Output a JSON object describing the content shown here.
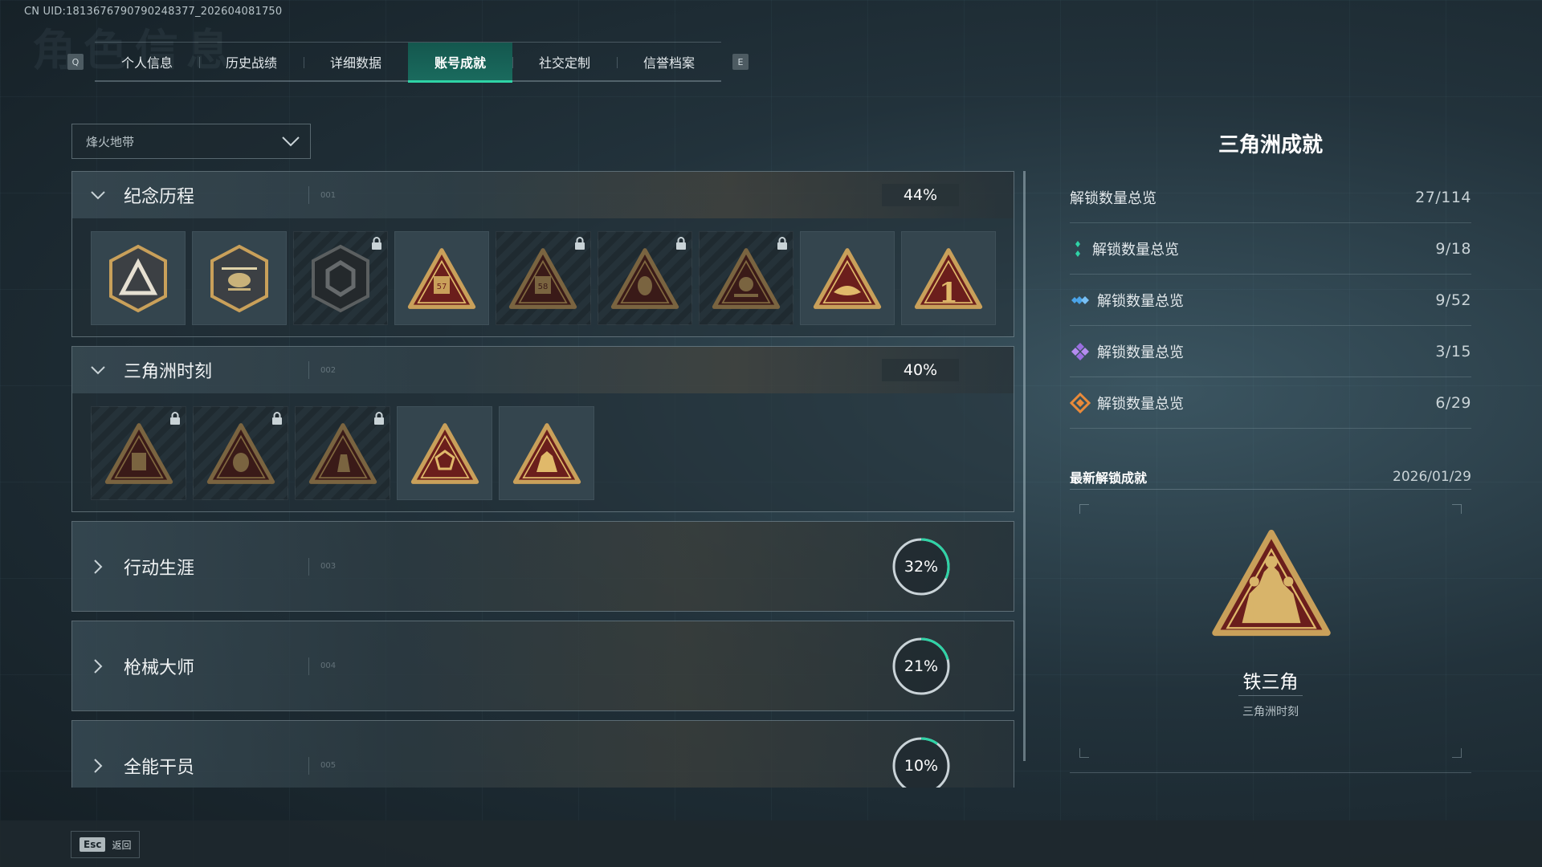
{
  "uid": "CN UID:1813676790790248377_202604081750",
  "tabbar": {
    "left_key": "Q",
    "right_key": "E",
    "tabs": [
      {
        "label": "个人信息"
      },
      {
        "label": "历史战绩"
      },
      {
        "label": "详细数据"
      },
      {
        "label": "账号成就",
        "active": true
      },
      {
        "label": "社交定制"
      },
      {
        "label": "信誉档案"
      }
    ]
  },
  "mode_select": {
    "value": "烽火地带",
    "icon": "chevron-down-icon"
  },
  "categories": [
    {
      "name": "纪念历程",
      "index": "001",
      "progress": 44,
      "progress_label": "44%",
      "expanded": true,
      "badges": [
        {
          "icon": "triangle-shield-badge",
          "locked": false
        },
        {
          "icon": "helicopter-badge",
          "locked": false
        },
        {
          "icon": "hex-emblem-badge",
          "locked": true
        },
        {
          "icon": "vault-57-badge",
          "locked": false
        },
        {
          "icon": "vault-58-badge",
          "locked": true
        },
        {
          "icon": "masked-figure-badge",
          "locked": true
        },
        {
          "icon": "skull-soldier-badge",
          "locked": true
        },
        {
          "icon": "hands-triangle-badge",
          "locked": false
        },
        {
          "icon": "number-one-badge",
          "locked": false
        }
      ]
    },
    {
      "name": "三角洲时刻",
      "index": "002",
      "progress": 40,
      "progress_label": "40%",
      "expanded": true,
      "badges": [
        {
          "icon": "robot-badge",
          "locked": true
        },
        {
          "icon": "masked-face-badge",
          "locked": true
        },
        {
          "icon": "kneeling-soldier-badge",
          "locked": true
        },
        {
          "icon": "hands-dice-badge",
          "locked": false
        },
        {
          "icon": "iron-triangle-badge",
          "locked": false
        }
      ]
    },
    {
      "name": "行动生涯",
      "index": "003",
      "progress": 32,
      "progress_label": "32%",
      "expanded": false
    },
    {
      "name": "枪械大师",
      "index": "004",
      "progress": 21,
      "progress_label": "21%",
      "expanded": false
    },
    {
      "name": "全能干员",
      "index": "005",
      "progress": 10,
      "progress_label": "10%",
      "expanded": false
    }
  ],
  "summary": {
    "title": "三角洲成就",
    "total": {
      "label": "解锁数量总览",
      "value": "27/114"
    },
    "tiers": [
      {
        "label": "解锁数量总览",
        "value": "9/18",
        "icon": "green-diamond-icon",
        "color": "#2fd3a6"
      },
      {
        "label": "解锁数量总览",
        "value": "9/52",
        "icon": "blue-diamond-icon",
        "color": "#4aa3e8"
      },
      {
        "label": "解锁数量总览",
        "value": "3/15",
        "icon": "purple-diamond-icon",
        "color": "#9a6ee0"
      },
      {
        "label": "解锁数量总览",
        "value": "6/29",
        "icon": "orange-diamond-icon",
        "color": "#e98a3a"
      }
    ]
  },
  "latest": {
    "label": "最新解锁成就",
    "date": "2026/01/29",
    "name": "铁三角",
    "category": "三角洲时刻",
    "icon": "iron-triangle-badge"
  },
  "footer": {
    "key": "Esc",
    "label": "返回"
  },
  "colors": {
    "accent": "#2fd3a6",
    "badge_gold": "#c9a05a",
    "badge_red": "#6b1e1c"
  }
}
